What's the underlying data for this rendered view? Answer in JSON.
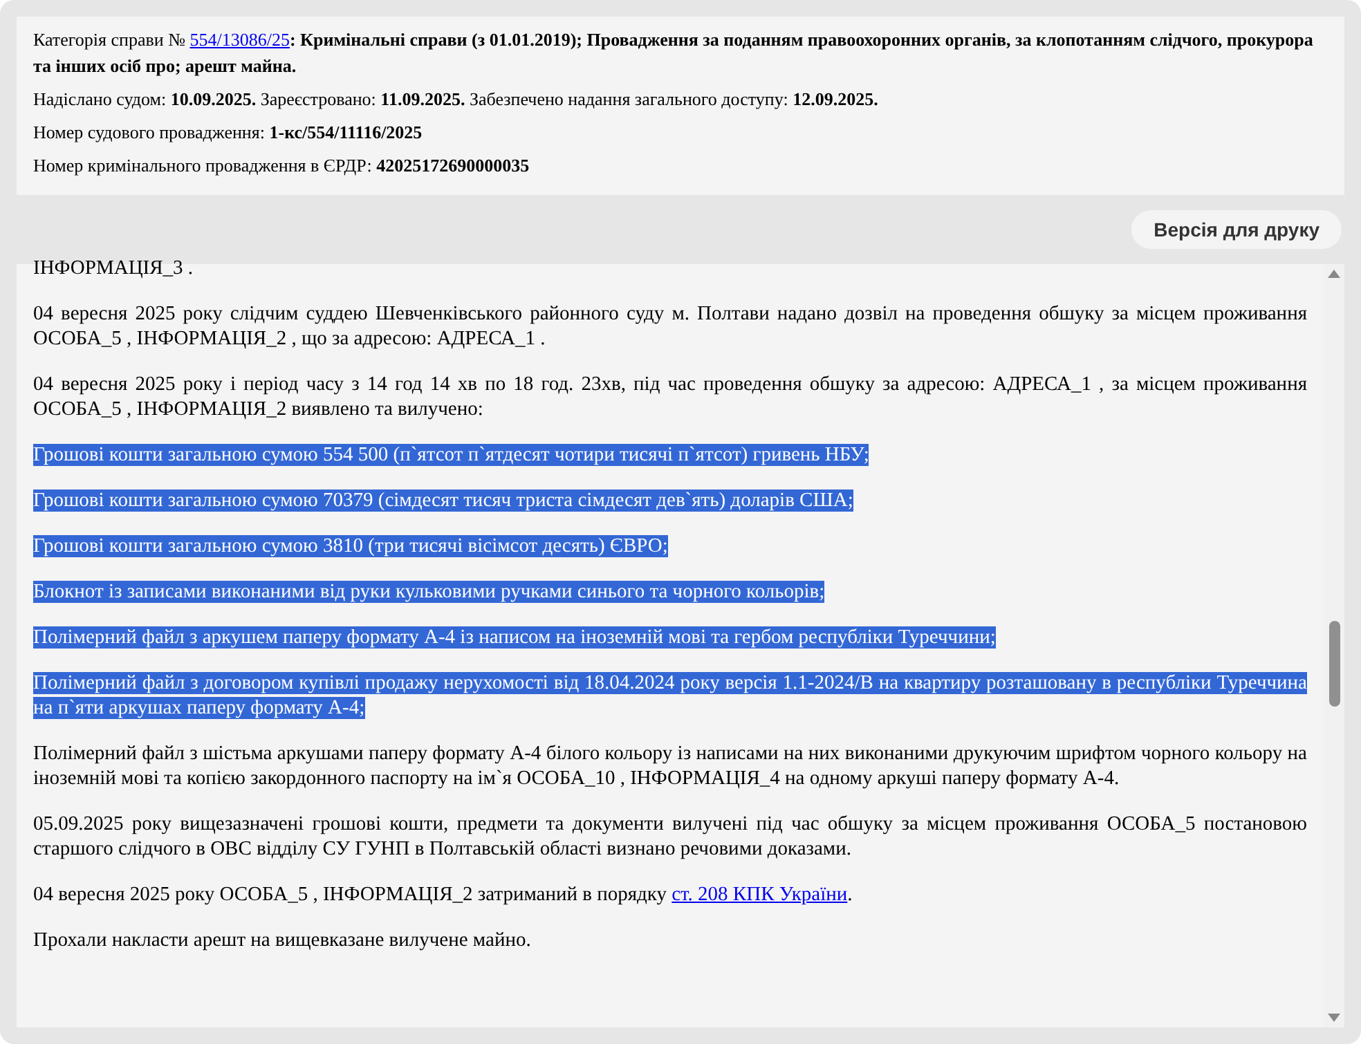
{
  "header": {
    "lines": [
      [
        {
          "kind": "text",
          "text": "Категорія справи № "
        },
        {
          "kind": "link",
          "text": "554/13086/25"
        },
        {
          "kind": "bold",
          "text": ": Кримінальні справи (з 01.01.2019); Провадження за поданням правоохоронних органів, за клопотанням слідчого, прокурора та інших осіб про; арешт майна."
        }
      ],
      [
        {
          "kind": "text",
          "text": "Надіслано судом: "
        },
        {
          "kind": "bold",
          "text": "10.09.2025."
        },
        {
          "kind": "text",
          "text": " Зареєстровано: "
        },
        {
          "kind": "bold",
          "text": "11.09.2025."
        },
        {
          "kind": "text",
          "text": " Забезпечено надання загального доступу: "
        },
        {
          "kind": "bold",
          "text": "12.09.2025."
        }
      ],
      [
        {
          "kind": "text",
          "text": "Номер судового провадження: "
        },
        {
          "kind": "bold",
          "text": "1-кс/554/11116/2025"
        }
      ],
      [
        {
          "kind": "text",
          "text": "Номер кримінального провадження в ЄРДР: "
        },
        {
          "kind": "bold",
          "text": "42025172690000035"
        }
      ]
    ]
  },
  "print_button": "Версія для друку",
  "document": {
    "paragraphs": [
      {
        "selected": false,
        "parts": [
          {
            "kind": "text",
            "text": "ІНФОРМАЦІЯ_3 ."
          }
        ]
      },
      {
        "selected": false,
        "parts": [
          {
            "kind": "text",
            "text": "04 вересня 2025 року слідчим суддею Шевченківського районного суду м. Полтави надано дозвіл на проведення обшуку за місцем проживання ОСОБА_5 , ІНФОРМАЦІЯ_2 , що за адресою: АДРЕСА_1 ."
          }
        ]
      },
      {
        "selected": false,
        "parts": [
          {
            "kind": "text",
            "text": "04 вересня 2025 року і період часу з 14 год 14 хв по 18 год. 23хв, під час проведення обшуку за адресою: АДРЕСА_1 , за місцем проживання ОСОБА_5 , ІНФОРМАЦІЯ_2 виявлено та вилучено:"
          }
        ]
      },
      {
        "selected": true,
        "parts": [
          {
            "kind": "text",
            "text": "Грошові кошти загальною сумою 554 500 (п`ятсот п`ятдесят чотири тисячі п`ятсот) гривень НБУ;"
          }
        ]
      },
      {
        "selected": true,
        "parts": [
          {
            "kind": "text",
            "text": "Грошові кошти загальною сумою 70379 (сімдесят тисяч триста сімдесят дев`ять) доларів США;"
          }
        ]
      },
      {
        "selected": true,
        "parts": [
          {
            "kind": "text",
            "text": "Грошові кошти загальною сумою 3810 (три тисячі вісімсот десять) ЄВРО;"
          }
        ]
      },
      {
        "selected": true,
        "parts": [
          {
            "kind": "text",
            "text": "Блокнот із записами виконаними від руки кульковими ручками синього та чорного кольорів;"
          }
        ]
      },
      {
        "selected": true,
        "parts": [
          {
            "kind": "text",
            "text": "Полімерний файл з аркушем паперу формату А-4 із написом на іноземній мові та гербом республіки Туреччини;"
          }
        ]
      },
      {
        "selected": true,
        "parts": [
          {
            "kind": "text",
            "text": "Полімерний файл з договором купівлі продажу нерухомості від 18.04.2024 року версія 1.1-2024/В на квартиру розташовану в республіки Туреччина на п`яти аркушах паперу формату А-4;"
          }
        ]
      },
      {
        "selected": false,
        "parts": [
          {
            "kind": "text",
            "text": "Полімерний файл з шістьма аркушами паперу формату А-4 білого кольору із написами на них виконаними друкуючим шрифтом чорного кольору на іноземній мові та копією закордонного паспорту на ім`я ОСОБА_10 , ІНФОРМАЦІЯ_4 на одному аркуші паперу формату А-4."
          }
        ]
      },
      {
        "selected": false,
        "parts": [
          {
            "kind": "text",
            "text": "05.09.2025 року вищезазначені грошові кошти, предмети та документи вилучені під час обшуку за місцем проживання ОСОБА_5 постановою старшого слідчого в ОВС відділу СУ ГУНП в Полтавській області визнано речовими доказами."
          }
        ]
      },
      {
        "selected": false,
        "parts": [
          {
            "kind": "text",
            "text": "04 вересня 2025 року ОСОБА_5 , ІНФОРМАЦІЯ_2 затриманий в порядку "
          },
          {
            "kind": "link",
            "text": "ст. 208 КПК України"
          },
          {
            "kind": "text",
            "text": "."
          }
        ]
      },
      {
        "selected": false,
        "parts": [
          {
            "kind": "text",
            "text": "Прохали накласти арешт на вищевказане вилучене майно."
          }
        ]
      }
    ]
  }
}
